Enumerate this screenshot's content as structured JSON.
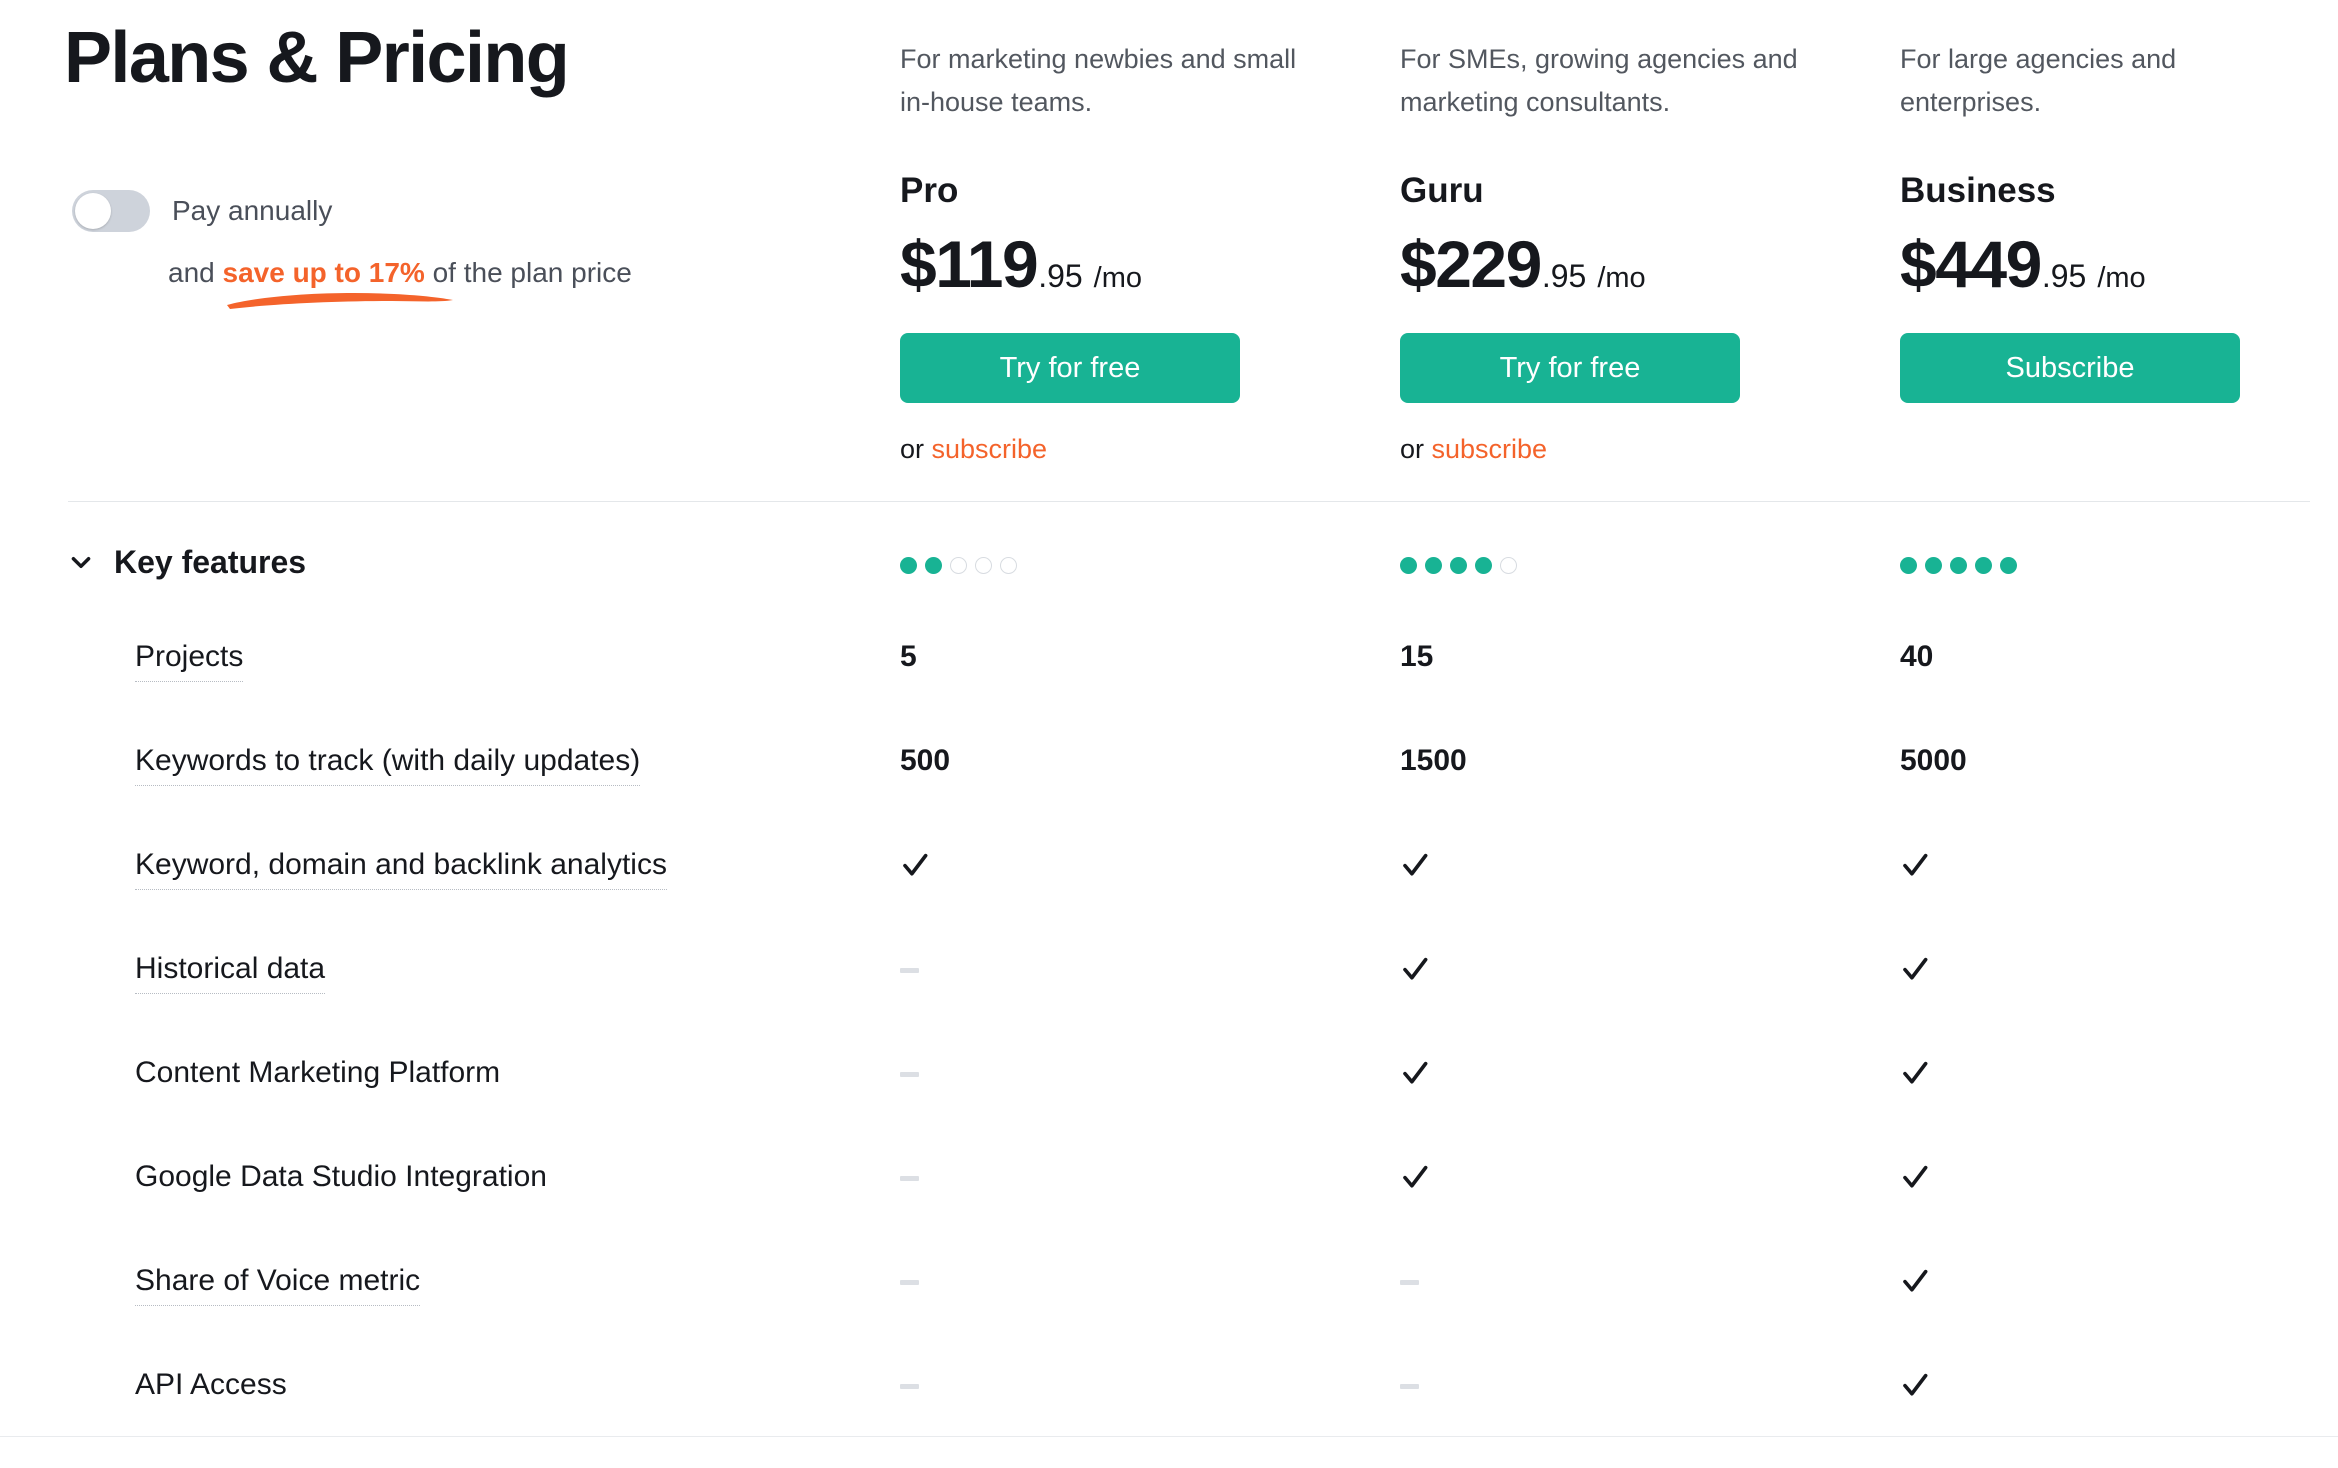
{
  "header": {
    "title": "Plans & Pricing",
    "billing_toggle": {
      "label": "Pay annually",
      "state": "off",
      "save_prefix": "and ",
      "save_accent": "save up to 17%",
      "save_suffix": " of the plan price"
    }
  },
  "colors": {
    "accent_green": "#18b394",
    "accent_orange": "#f4632b",
    "text_dark": "#16181d",
    "text_muted": "#52575f",
    "divider": "#e4e7ea",
    "dot_off": "#d8dce1",
    "dash": "#dcdfe4"
  },
  "plans": [
    {
      "description": "For marketing newbies and small in-house teams.",
      "name": "Pro",
      "price_main": "$119",
      "price_cents": ".95",
      "price_period": "/mo",
      "cta_label": "Try for free",
      "secondary_prefix": "or ",
      "secondary_link": "subscribe",
      "has_secondary": true,
      "rating_filled": 2,
      "rating_total": 5
    },
    {
      "description": "For SMEs, growing agencies and marketing consultants.",
      "name": "Guru",
      "price_main": "$229",
      "price_cents": ".95",
      "price_period": "/mo",
      "cta_label": "Try for free",
      "secondary_prefix": "or ",
      "secondary_link": "subscribe",
      "has_secondary": true,
      "rating_filled": 4,
      "rating_total": 5
    },
    {
      "description": "For large agencies and enterprises.",
      "name": "Business",
      "price_main": "$449",
      "price_cents": ".95",
      "price_period": "/mo",
      "cta_label": "Subscribe",
      "secondary_prefix": "",
      "secondary_link": "",
      "has_secondary": false,
      "rating_filled": 5,
      "rating_total": 5
    }
  ],
  "features_section": {
    "title": "Key features",
    "expanded": true,
    "chevron": "chevron-down-icon"
  },
  "features": [
    {
      "label": "Projects",
      "has_tooltip": true,
      "values": [
        "5",
        "15",
        "40"
      ],
      "types": [
        "text",
        "text",
        "text"
      ]
    },
    {
      "label": "Keywords to track (with daily updates)",
      "has_tooltip": true,
      "values": [
        "500",
        "1500",
        "5000"
      ],
      "types": [
        "text",
        "text",
        "text"
      ]
    },
    {
      "label": "Keyword, domain and backlink analytics",
      "has_tooltip": true,
      "values": [
        "check",
        "check",
        "check"
      ],
      "types": [
        "check",
        "check",
        "check"
      ]
    },
    {
      "label": "Historical data",
      "has_tooltip": true,
      "values": [
        "dash",
        "check",
        "check"
      ],
      "types": [
        "dash",
        "check",
        "check"
      ]
    },
    {
      "label": "Content Marketing Platform",
      "has_tooltip": false,
      "values": [
        "dash",
        "check",
        "check"
      ],
      "types": [
        "dash",
        "check",
        "check"
      ]
    },
    {
      "label": "Google Data Studio Integration",
      "has_tooltip": false,
      "values": [
        "dash",
        "check",
        "check"
      ],
      "types": [
        "dash",
        "check",
        "check"
      ]
    },
    {
      "label": "Share of Voice metric",
      "has_tooltip": true,
      "values": [
        "dash",
        "dash",
        "check"
      ],
      "types": [
        "dash",
        "dash",
        "check"
      ]
    },
    {
      "label": "API Access",
      "has_tooltip": false,
      "values": [
        "dash",
        "dash",
        "check"
      ],
      "types": [
        "dash",
        "dash",
        "check"
      ]
    }
  ]
}
